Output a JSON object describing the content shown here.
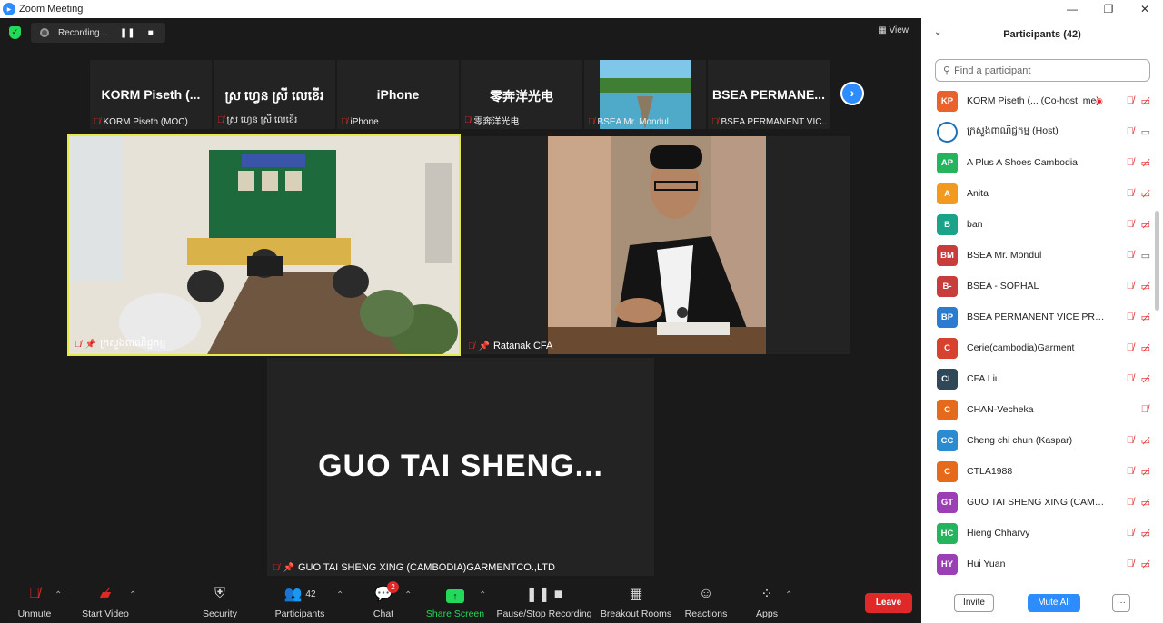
{
  "window": {
    "title": "Zoom Meeting"
  },
  "topbar": {
    "recording_label": "Recording...",
    "view_label": "View"
  },
  "strip": [
    {
      "tile_text": "KORM Piseth (...",
      "label": "KORM Piseth (MOC)"
    },
    {
      "tile_text": "ស្រ ហ្វេន ស្រី លេខើរ",
      "label": "ស្រ ហ្វេន ស្រី លេខើរ"
    },
    {
      "tile_text": "iPhone",
      "label": "iPhone"
    },
    {
      "tile_text": "零奔洋光电",
      "label": "零奔洋光电"
    },
    {
      "tile_text": "",
      "label": "BSEA  Mr. Mondul"
    },
    {
      "tile_text": "BSEA PERMANE...",
      "label": "BSEA PERMANENT VIC..."
    }
  ],
  "tiles": {
    "host": {
      "label": "ក្រសួងពាណិជ្ជកម្ម"
    },
    "speaker": {
      "label": "Ratanak CFA"
    },
    "guo": {
      "big_name": "GUO TAI SHENG...",
      "label": "GUO TAI SHENG XING (CAMBODIA)GARMENTCO.,LTD"
    }
  },
  "toolbar": {
    "unmute": "Unmute",
    "start_video": "Start Video",
    "security": "Security",
    "participants": "Participants",
    "participants_count": "42",
    "chat": "Chat",
    "chat_badge": "2",
    "share": "Share Screen",
    "record": "Pause/Stop Recording",
    "breakout": "Breakout Rooms",
    "reactions": "Reactions",
    "apps": "Apps",
    "leave": "Leave"
  },
  "panel": {
    "title": "Participants (42)",
    "search_placeholder": "Find a participant",
    "invite": "Invite",
    "mute_all": "Mute All",
    "more": "···",
    "participants": [
      {
        "initials": "KP",
        "name": "KORM Piseth (... (Co-host, me)",
        "color": "#e8622a",
        "cam": "off",
        "rec": true
      },
      {
        "initials": "",
        "name": "ក្រសួងពាណិជ្ជកម្ម (Host)",
        "color": "#1c6fb8",
        "cam": "on",
        "rec": false
      },
      {
        "initials": "AP",
        "name": "A Plus A Shoes Cambodia",
        "color": "#26b35e",
        "cam": "off",
        "rec": false
      },
      {
        "initials": "A",
        "name": "Anita",
        "color": "#f19a1f",
        "cam": "off",
        "rec": false
      },
      {
        "initials": "B",
        "name": "ban",
        "color": "#1aa388",
        "cam": "off",
        "rec": false
      },
      {
        "initials": "BM",
        "name": "BSEA  Mr. Mondul",
        "color": "#c93c3c",
        "cam": "on",
        "rec": false
      },
      {
        "initials": "B-",
        "name": "BSEA - SOPHAL",
        "color": "#c93c3c",
        "cam": "off",
        "rec": false
      },
      {
        "initials": "BP",
        "name": "BSEA PERMANENT VICE PRESIDE...",
        "color": "#2b7bd1",
        "cam": "off",
        "rec": false
      },
      {
        "initials": "C",
        "name": "Cerie(cambodia)Garment",
        "color": "#d6422e",
        "cam": "off",
        "rec": false
      },
      {
        "initials": "CL",
        "name": "CFA Liu",
        "color": "#2f4756",
        "cam": "off",
        "rec": false
      },
      {
        "initials": "C",
        "name": "CHAN-Vecheka",
        "color": "#e56a1c",
        "cam": "none",
        "rec": false
      },
      {
        "initials": "CC",
        "name": "Cheng chi chun (Kaspar)",
        "color": "#2a8bd0",
        "cam": "off",
        "rec": false
      },
      {
        "initials": "C",
        "name": "CTLA1988",
        "color": "#e56a1c",
        "cam": "off",
        "rec": false
      },
      {
        "initials": "GT",
        "name": "GUO TAI SHENG XING (CAMBOD...",
        "color": "#9b3fb5",
        "cam": "off",
        "rec": false
      },
      {
        "initials": "HC",
        "name": "Hieng Chharvy",
        "color": "#26b35e",
        "cam": "off",
        "rec": false
      },
      {
        "initials": "HY",
        "name": "Hui Yuan",
        "color": "#9b3fb5",
        "cam": "off",
        "rec": false
      }
    ]
  }
}
